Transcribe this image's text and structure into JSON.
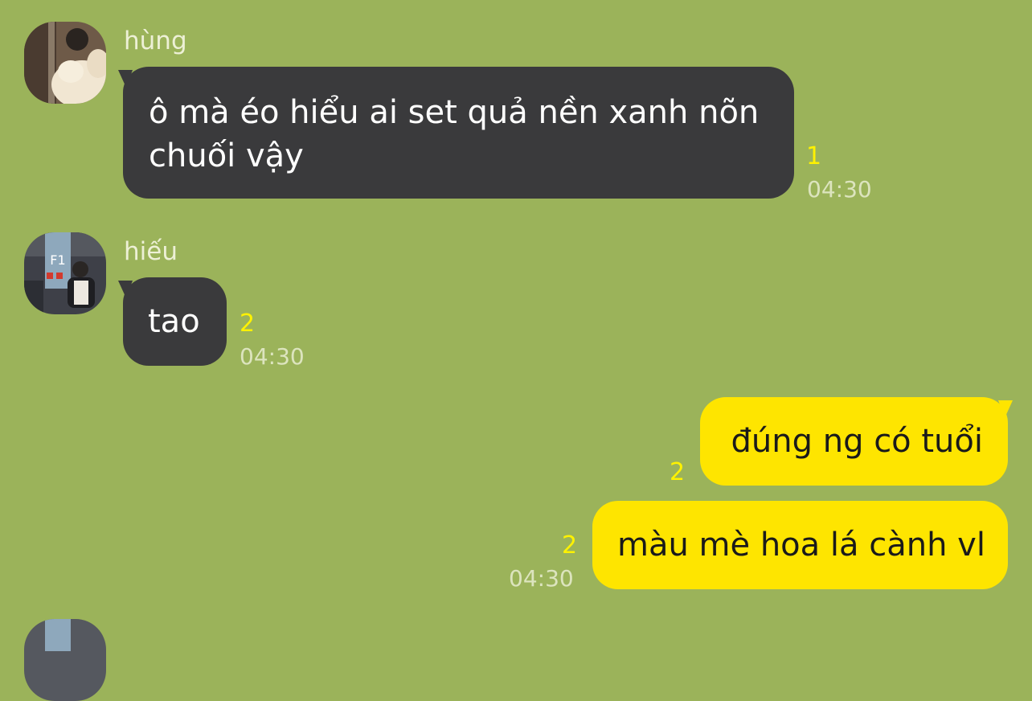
{
  "chat": {
    "background": "#9BB35A",
    "incoming_bubble_color": "#3A3A3C",
    "outgoing_bubble_color": "#FEE500",
    "unread_color": "#FFF200"
  },
  "messages": [
    {
      "sender": "hùng",
      "avatar_icon": "avatar-hung-icon",
      "lines": [
        "ô mà éo hiểu ai set quả nền xanh nõn",
        "chuối vậy"
      ],
      "unread": "1",
      "time": "04:30"
    },
    {
      "sender": "hiếu",
      "avatar_icon": "avatar-hieu-icon",
      "avatar_sign": "F1",
      "lines": [
        "tao"
      ],
      "unread": "2",
      "time": "04:30"
    },
    {
      "lines": [
        "đúng ng có tuổi"
      ],
      "unread": "2"
    },
    {
      "lines": [
        "màu mè hoa lá cành vl"
      ],
      "unread": "2",
      "time": "04:30"
    }
  ]
}
